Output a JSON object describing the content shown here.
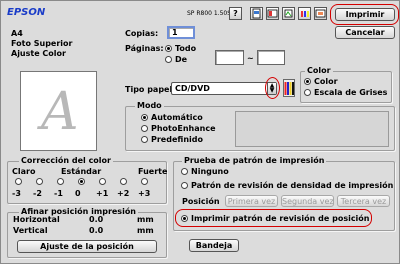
{
  "brand": "EPSON",
  "printer_model": "SP R800 1.50S",
  "toolbar": {
    "help_label": "?",
    "print_label": "Imprimir",
    "cancel_label": "Cancelar"
  },
  "summary": [
    "A4",
    "Foto Superior",
    "Ajuste Color"
  ],
  "preview_letter": "A",
  "copies": {
    "label": "Copias:",
    "value": "1"
  },
  "pages": {
    "label": "Páginas:",
    "all_label": "Todo",
    "from_label": "De",
    "from_value": "",
    "separator": "~",
    "to_value": ""
  },
  "paper_type": {
    "label": "Tipo papel:",
    "value": "CD/DVD"
  },
  "color": {
    "title": "Color",
    "options": [
      "Color",
      "Escala de Grises"
    ],
    "selected": "Color"
  },
  "mode": {
    "title": "Modo",
    "options": [
      "Automático",
      "PhotoEnhance",
      "Predefinido"
    ],
    "selected": "Automático"
  },
  "color_correction": {
    "title": "Corrección del color",
    "left_label": "Claro",
    "center_label": "Estándar",
    "right_label": "Fuerte",
    "scale": [
      "-3",
      "-2",
      "-1",
      "0",
      "+1",
      "+2",
      "+3"
    ],
    "selected": "0"
  },
  "position_adjust": {
    "title": "Afinar posición impresión",
    "horizontal_label": "Horizontal",
    "horizontal_value": "0.0",
    "vertical_label": "Vertical",
    "vertical_value": "0.0",
    "unit": "mm",
    "button_label": "Ajuste de la posición"
  },
  "test_pattern": {
    "title": "Prueba de patrón de impresión",
    "options": [
      "Ninguno",
      "Patrón de revisión de densidad de impresión",
      "Imprimir patrón de revisión de posición"
    ],
    "selected": "Imprimir patrón de revisión de posición",
    "position_label": "Posición",
    "position_buttons": [
      "Primera vez",
      "Segunda vez",
      "Tercera vez"
    ]
  },
  "tray_label": "Bandeja",
  "colors": {
    "highlight": "#d40000",
    "dialog_bg": "#dcdcdc",
    "brand": "#1a3cc8"
  },
  "icons": [
    "help-icon",
    "print-settings-icon",
    "layout-icon",
    "utility-icon",
    "ink-icon",
    "info-icon",
    "cd-icon",
    "ink-cartridge-icon"
  ]
}
